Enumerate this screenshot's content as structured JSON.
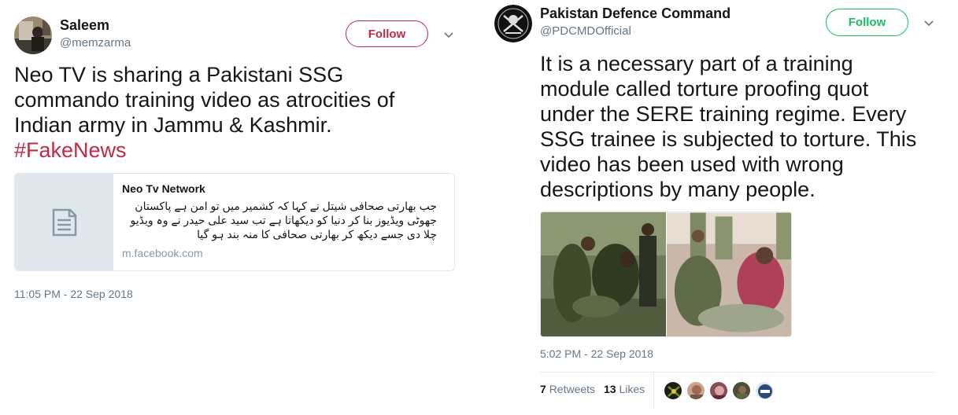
{
  "tweet_left": {
    "author_name": "Saleem",
    "author_handle": "@memzarma",
    "follow_label": "Follow",
    "text_main": "Neo TV is sharing a Pakistani SSG commando training video as atrocities of Indian army in Jammu & Kashmir.",
    "text_line1": "Neo TV is sharing a Pakistani SSG",
    "text_line2": "commando training video as atrocities of",
    "text_line3": "Indian army in Jammu & Kashmir.",
    "hashtag": "#FakeNews",
    "card": {
      "title": "Neo Tv Network",
      "desc_line1": "جب بھارتی صحافی شیتل نے کہا کہ کشمیر میں تو امن ہے پاکستان",
      "desc_line2": "جھوٹی ویڈیوز بنا کر دنیا کو دیکھاتا ہے تب سید علی حیدر نے وہ ویڈیو",
      "desc_line3": "چلا دی جسے دیکھ کر بھارتی صحافی کا منہ بند ہو گیا",
      "url": "m.facebook.com"
    },
    "timestamp": "11:05 PM - 22 Sep 2018"
  },
  "tweet_right": {
    "author_name": "Pakistan Defence Command",
    "author_handle": "@PDCMDOfficial",
    "follow_label": "Follow",
    "text_lines": [
      "It is a necessary part of a training",
      "module called torture proofing quot",
      "under the SERE training regime. Every",
      "SSG trainee is subjected to torture. This",
      "video has been used with wrong",
      "descriptions by many people."
    ],
    "timestamp": "5:02 PM - 22 Sep 2018",
    "retweets_count": "7",
    "retweets_label": "Retweets",
    "likes_count": "13",
    "likes_label": "Likes"
  },
  "colors": {
    "accent": "#c22a44",
    "follow_left": "#c22a44",
    "follow_right": "#17bf63",
    "secondary_text": "#657786"
  },
  "icons": {
    "chevron": "chevron-down-icon",
    "card_placeholder": "document-icon"
  }
}
